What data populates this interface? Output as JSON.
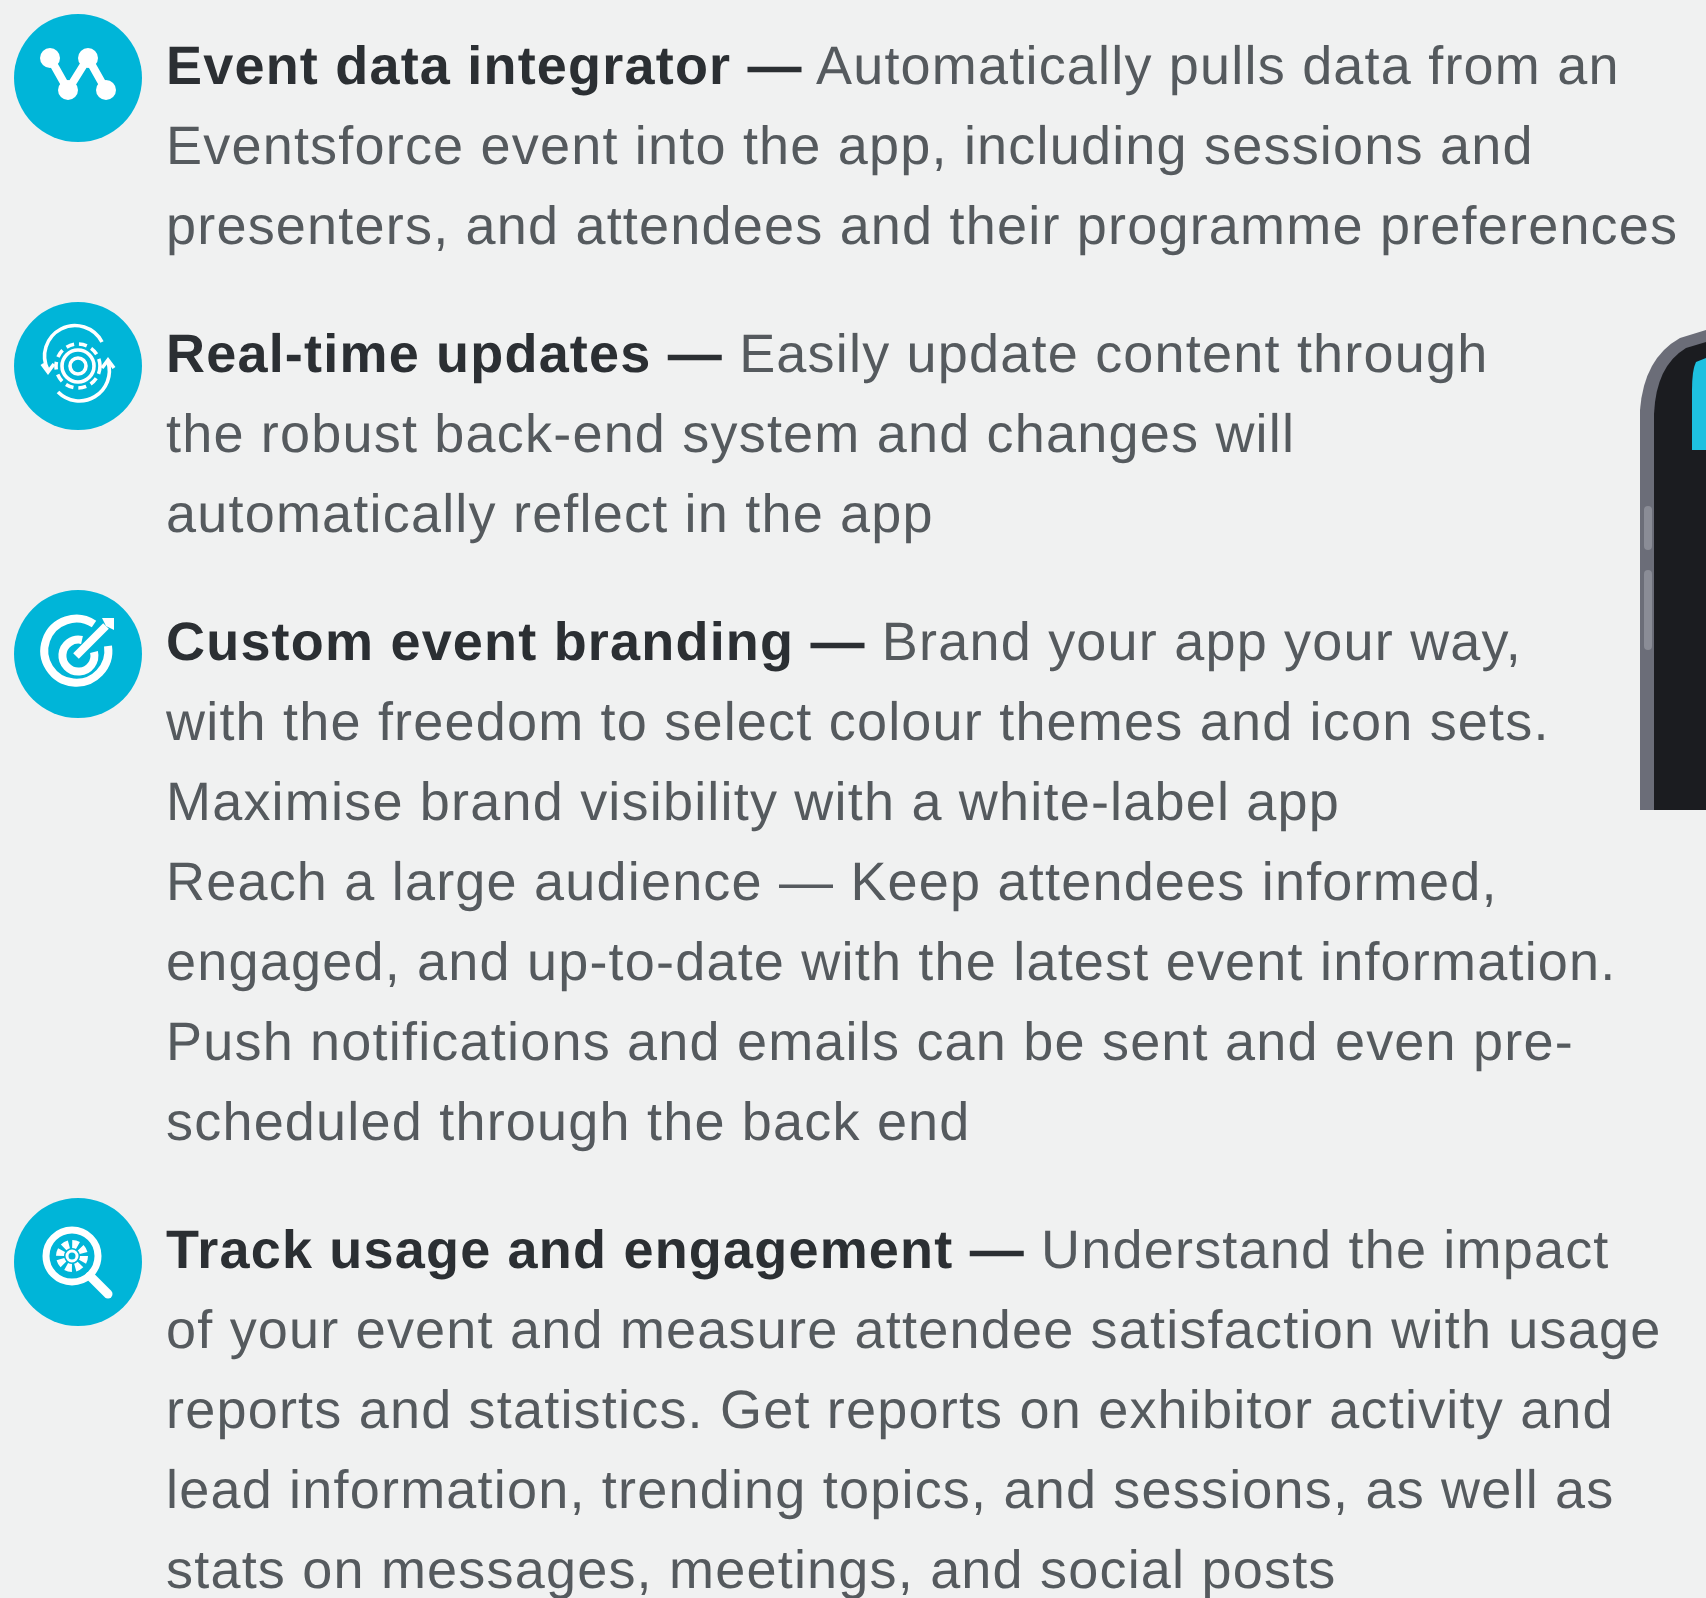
{
  "features": [
    {
      "text": "**Event data integrator —** Automatically pulls data from an\nEventsforce event into the app, including sessions and\npresenters, and attendees and their programme preferences"
    },
    {
      "text": "**Real-time updates —** Easily update content through\nthe robust back-end system and changes will\nautomatically reflect in the app"
    },
    {
      "text": "**Custom event branding —** Brand your app your way,\nwith the freedom to select colour themes and icon sets.\nMaximise brand visibility with a white-label app\nReach a large audience — Keep attendees informed,\nengaged, and up-to-date with the latest event information.\nPush notifications and emails can be sent and even pre-\nscheduled through the back end"
    },
    {
      "text": "**Track usage and engagement —** Understand the impact\nof your event and measure attendee satisfaction with usage\nreports and statistics. Get reports on exhibitor activity and\nlead information, trending topics, and sessions, as well as\nstats on messages, meetings, and social posts"
    }
  ]
}
